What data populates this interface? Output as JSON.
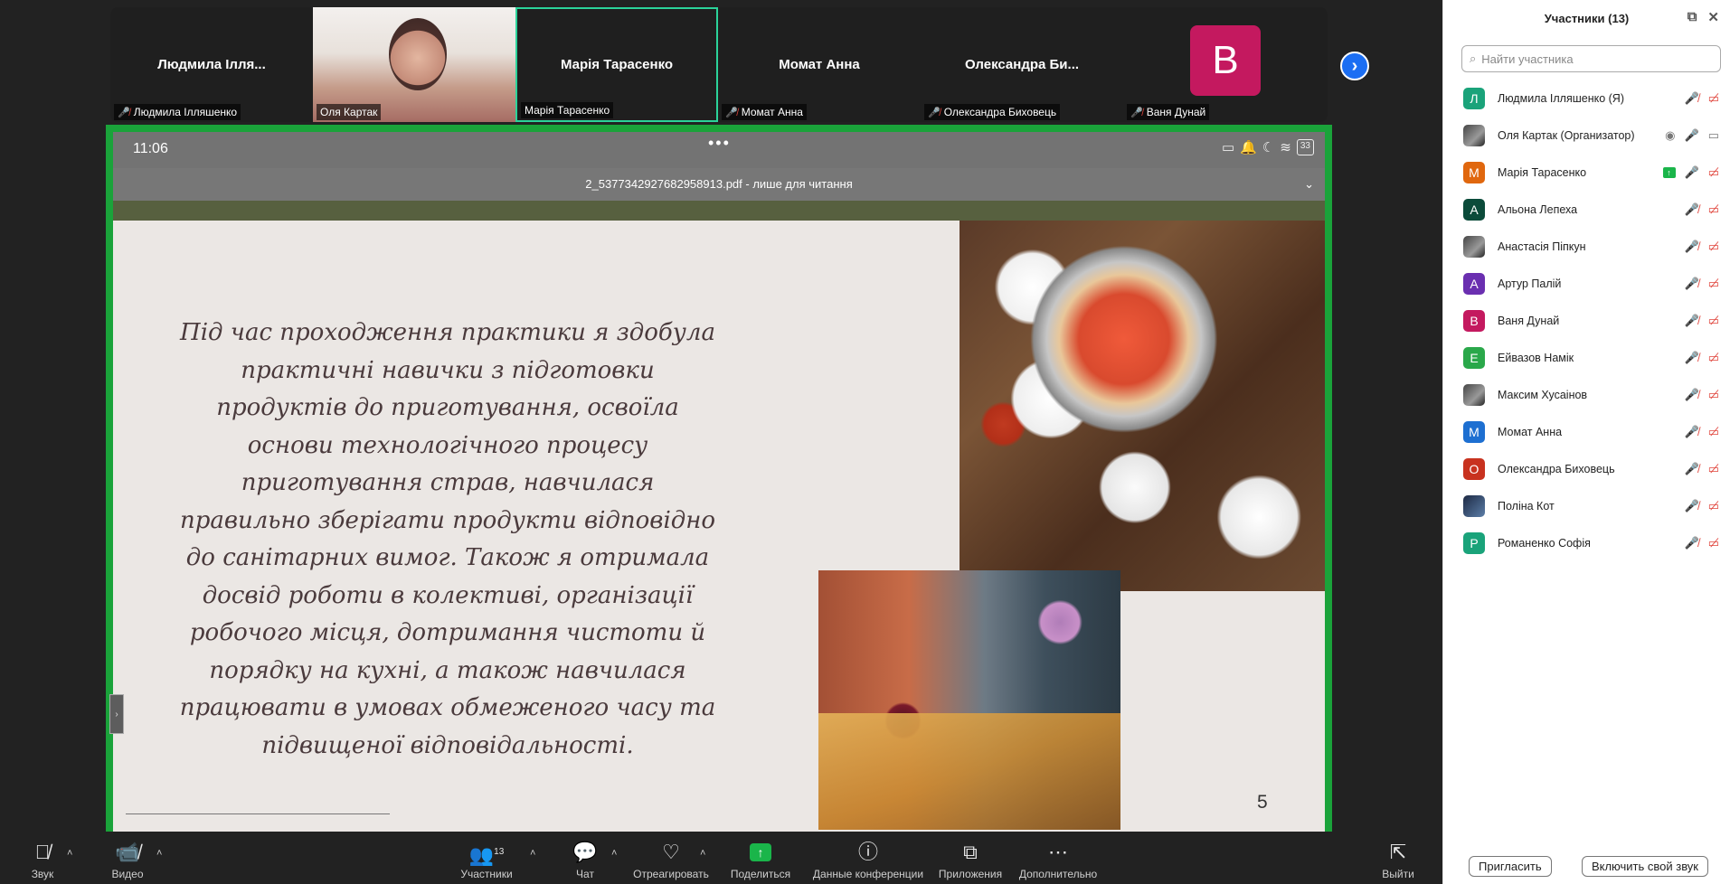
{
  "strip": {
    "tiles": [
      {
        "big": "Людмила Ілля...",
        "label": "Людмила Ілляшенко",
        "muted": true
      },
      {
        "big": "",
        "label": "Оля Картак",
        "muted": false
      },
      {
        "big": "Марія Тарасенко",
        "label": "Марія Тарасенко",
        "muted": false
      },
      {
        "big": "Момат Анна",
        "label": "Момат Анна",
        "muted": true
      },
      {
        "big": "Олександра  Би...",
        "label": "Олександра Биховець",
        "muted": true
      },
      {
        "big": "B",
        "label": "Ваня Дунай",
        "muted": true
      }
    ]
  },
  "share": {
    "time": "11:06",
    "battery": "33",
    "pdf_title": "2_5377342927682958913.pdf - лише для читання",
    "slide_text": "Під час проходження практики я здобула практичні навички з підготовки продуктів до приготування, освоїла основи технологічного процесу приготування страв, навчилася правильно зберігати продукти відповідно до санітарних вимог. Також я отримала досвід роботи в колективі, організації робочого місця, дотримання чистоти й порядку на кухні, а також навчилася працювати в умовах обмеженого часу та підвищеної відповідальності.",
    "page_number": "5"
  },
  "toolbar": {
    "sound": "Звук",
    "video": "Видео",
    "participants": "Участники",
    "participants_count": "13",
    "chat": "Чат",
    "react": "Отреагировать",
    "share": "Поделиться",
    "info": "Данные конференции",
    "apps": "Приложения",
    "more": "Дополнительно",
    "leave": "Выйти"
  },
  "panel": {
    "title": "Участники (13)",
    "search_placeholder": "Найти участника",
    "participants": [
      {
        "initial": "Л",
        "name": "Людмила Ілляшенко (Я)",
        "color": "#1aa37a"
      },
      {
        "initial": "",
        "name": "Оля Картак (Организатор)",
        "color": "#7a6a58"
      },
      {
        "initial": "М",
        "name": "Марія Тарасенко",
        "color": "#e0670e"
      },
      {
        "initial": "А",
        "name": "Альона Лепеха",
        "color": "#0b4b3a"
      },
      {
        "initial": "",
        "name": "Анастасія Піпкун",
        "color": "#333333"
      },
      {
        "initial": "А",
        "name": "Артур Палій",
        "color": "#6a2fb0"
      },
      {
        "initial": "В",
        "name": "Ваня Дунай",
        "color": "#c4195f"
      },
      {
        "initial": "Е",
        "name": "Ейвазов Намік",
        "color": "#2aa84a"
      },
      {
        "initial": "",
        "name": "Максим Хусаінов",
        "color": "#555555"
      },
      {
        "initial": "М",
        "name": "Момат Анна",
        "color": "#1d6fd1"
      },
      {
        "initial": "О",
        "name": "Олександра Биховець",
        "color": "#c8321f"
      },
      {
        "initial": "",
        "name": "Поліна Кот",
        "color": "#2a3a50"
      },
      {
        "initial": "Р",
        "name": "Романенко Софія",
        "color": "#1aa37a"
      }
    ],
    "invite": "Пригласить",
    "unmute_self": "Включить свой звук"
  }
}
